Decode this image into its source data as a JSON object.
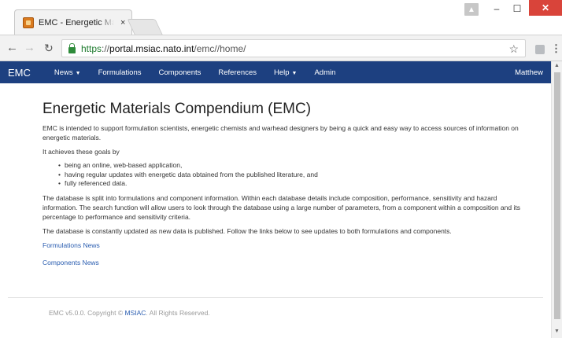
{
  "browser": {
    "tab_title": "EMC - Energetic Materials Compendium",
    "tab_close": "×",
    "url_scheme": "https",
    "url_sep": "://",
    "url_host": "portal.msiac.nato.int",
    "url_path": "/emc//home/",
    "window_user_icon": "person-icon",
    "min_label": "–",
    "max_label": "☐",
    "close_label": "✕"
  },
  "navbar": {
    "brand": "EMC",
    "items": [
      {
        "label": "News",
        "dropdown": true
      },
      {
        "label": "Formulations",
        "dropdown": false
      },
      {
        "label": "Components",
        "dropdown": false
      },
      {
        "label": "References",
        "dropdown": false
      },
      {
        "label": "Help",
        "dropdown": true
      },
      {
        "label": "Admin",
        "dropdown": false
      }
    ],
    "user": "Matthew",
    "bg_color": "#1d4080"
  },
  "main": {
    "title": "Energetic Materials Compendium (EMC)",
    "intro": "EMC is intended to support formulation scientists, energetic chemists and warhead designers by being a quick and easy way to access sources of information on energetic materials.",
    "goals_heading": "It achieves these goals by",
    "goals": [
      "being an online, web-based application,",
      "having regular updates with energetic data obtained from the published literature, and",
      "fully referenced data."
    ],
    "database_split": "The database is split into formulations and component information. Within each database details include composition, performance, sensitivity and hazard information. The search function will allow users to look through the database using a large number of parameters, from a component within a composition and its percentage to performance and sensitivity criteria.",
    "updates": "The database is constantly updated as new data is published. Follow the links below to see updates to both formulations and components.",
    "links": {
      "formulations_news": "Formulations News",
      "components_news": "Components News"
    }
  },
  "footer": {
    "prefix": "EMC v5.0.0. Copyright © ",
    "org": "MSIAC",
    "suffix": ". All Rights Reserved."
  },
  "colors": {
    "link": "#2a5db0",
    "close_button": "#d9443a"
  }
}
